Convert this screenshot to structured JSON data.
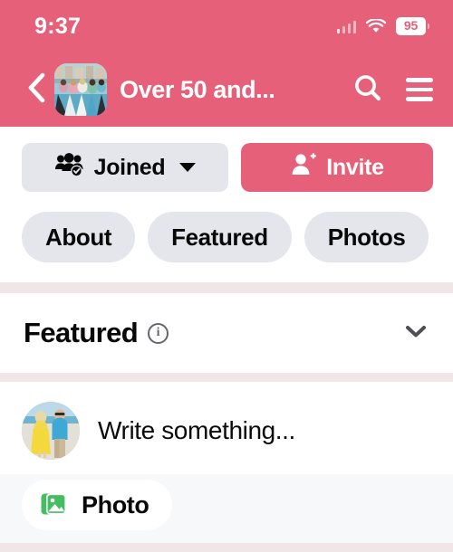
{
  "status_bar": {
    "time": "9:37",
    "battery_percent": "95",
    "cellular_icon": "cellular-signal-icon",
    "wifi_icon": "wifi-icon",
    "battery_icon": "battery-icon"
  },
  "header": {
    "back_icon": "back-chevron-icon",
    "group_avatar_alt": "group-avatar",
    "title": "Over 50 and...",
    "search_icon": "search-icon",
    "menu_icon": "hamburger-menu-icon",
    "background_color": "#E76079"
  },
  "actions": {
    "joined": {
      "label": "Joined",
      "icon": "group-check-icon",
      "chevron": "chevron-down-icon",
      "background_color": "#E4E6EB"
    },
    "invite": {
      "label": "Invite",
      "icon": "person-add-icon",
      "background_color": "#E76079"
    }
  },
  "tabs": [
    {
      "label": "About"
    },
    {
      "label": "Featured"
    },
    {
      "label": "Photos"
    }
  ],
  "featured": {
    "title": "Featured",
    "info_icon": "info-circle-icon",
    "info_glyph": "i",
    "collapse_icon": "chevron-down-icon"
  },
  "composer": {
    "avatar_alt": "user-avatar",
    "placeholder": "Write something...",
    "attachments": [
      {
        "label": "Photo",
        "icon": "photo-stack-icon",
        "color": "#45BD62"
      }
    ]
  }
}
